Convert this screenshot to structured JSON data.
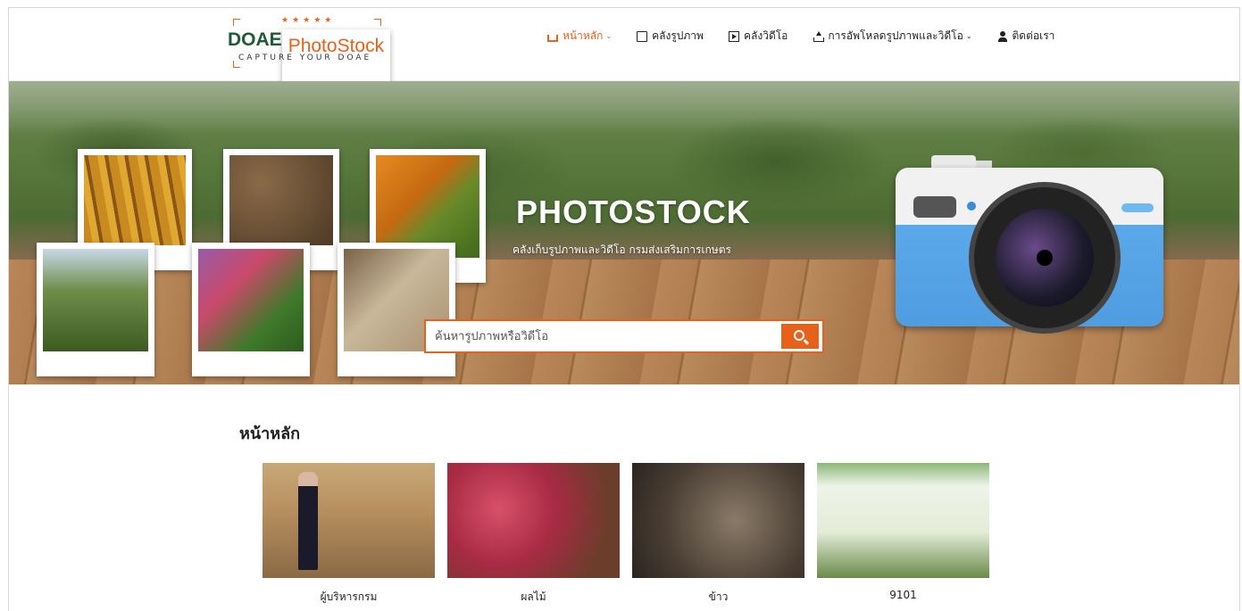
{
  "logo": {
    "stars": "★★★★★",
    "doae": "DOAE",
    "photostock": "PhotoStock",
    "tagline": "CAPTURE YOUR DOAE"
  },
  "nav": {
    "items": [
      {
        "label": "หน้าหลัก",
        "icon": "home-icon",
        "active": true,
        "dropdown": true
      },
      {
        "label": "คลังรูปภาพ",
        "icon": "image-icon",
        "active": false,
        "dropdown": false
      },
      {
        "label": "คลังวิดีโอ",
        "icon": "video-icon",
        "active": false,
        "dropdown": false
      },
      {
        "label": "การอัพโหลดรูปภาพและวิดีโอ",
        "icon": "upload-icon",
        "active": false,
        "dropdown": true
      },
      {
        "label": "ติดต่อเรา",
        "icon": "contact-icon",
        "active": false,
        "dropdown": false
      }
    ]
  },
  "hero": {
    "title": "PHOTOSTOCK",
    "subtitle": "คลังเก็บรูปภาพและวิดีโอ กรมส่งเสริมการเกษตร"
  },
  "search": {
    "placeholder": "ค้นหารูปภาพหรือวิดีโอ",
    "value": ""
  },
  "main": {
    "section_title": "หน้าหลัก",
    "categories": [
      {
        "label": "ผู้บริหารกรม"
      },
      {
        "label": "ผลไม้"
      },
      {
        "label": "ข้าว"
      },
      {
        "label": "9101"
      }
    ]
  },
  "colors": {
    "accent": "#e8611a",
    "brand_green": "#1e5a37",
    "camera_blue": "#5ba8ea"
  }
}
